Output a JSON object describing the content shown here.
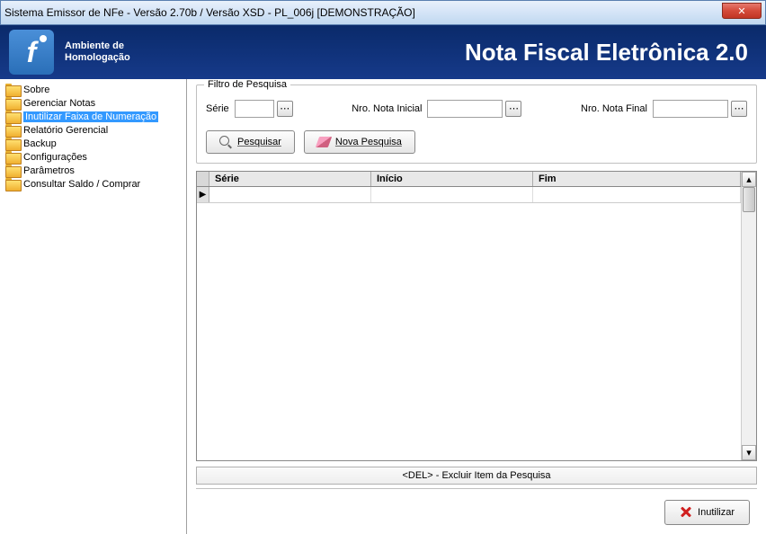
{
  "window": {
    "title": "Sistema Emissor de NFe - Versão 2.70b / Versão XSD - PL_006j [DEMONSTRAÇÃO]"
  },
  "header": {
    "env_line1": "Ambiente de",
    "env_line2": "Homologação",
    "title": "Nota Fiscal Eletrônica 2.0"
  },
  "sidebar": {
    "items": [
      {
        "label": "Sobre",
        "selected": false
      },
      {
        "label": "Gerenciar Notas",
        "selected": false
      },
      {
        "label": "Inutilizar Faixa de Numeração",
        "selected": true
      },
      {
        "label": "Relatório Gerencial",
        "selected": false
      },
      {
        "label": "Backup",
        "selected": false
      },
      {
        "label": "Configurações",
        "selected": false
      },
      {
        "label": "Parâmetros",
        "selected": false
      },
      {
        "label": "Consultar Saldo / Comprar",
        "selected": false
      }
    ]
  },
  "filter": {
    "legend": "Filtro de Pesquisa",
    "serie_label": "Série",
    "serie_value": "",
    "nota_inicial_label": "Nro. Nota Inicial",
    "nota_inicial_value": "",
    "nota_final_label": "Nro. Nota Final",
    "nota_final_value": "",
    "pesquisar_label": "Pesquisar",
    "nova_pesquisa_label": "Nova Pesquisa"
  },
  "grid": {
    "columns": {
      "serie": "Série",
      "inicio": "Início",
      "fim": "Fim"
    },
    "rows": [
      {
        "serie": "",
        "inicio": "",
        "fim": ""
      }
    ]
  },
  "hint": "<DEL> - Excluir Item da Pesquisa",
  "footer": {
    "inutilizar_label": "Inutilizar"
  }
}
